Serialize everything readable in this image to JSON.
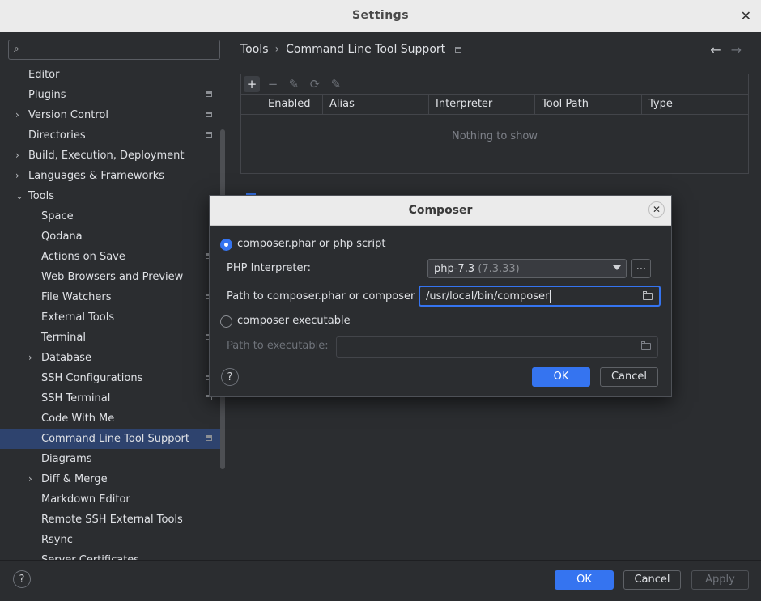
{
  "window": {
    "title": "Settings"
  },
  "sidebar": {
    "search_placeholder": "",
    "items": [
      {
        "label": "Editor",
        "level": 0,
        "expandable": false,
        "gear": false
      },
      {
        "label": "Plugins",
        "level": 0,
        "expandable": false,
        "gear": true
      },
      {
        "label": "Version Control",
        "level": 0,
        "expandable": true,
        "gear": true
      },
      {
        "label": "Directories",
        "level": 0,
        "expandable": false,
        "gear": true
      },
      {
        "label": "Build, Execution, Deployment",
        "level": 0,
        "expandable": true,
        "gear": false
      },
      {
        "label": "Languages & Frameworks",
        "level": 0,
        "expandable": true,
        "gear": false
      },
      {
        "label": "Tools",
        "level": 0,
        "expandable": true,
        "expanded": true,
        "gear": false
      },
      {
        "label": "Space",
        "level": 1,
        "expandable": false,
        "gear": false
      },
      {
        "label": "Qodana",
        "level": 1,
        "expandable": false,
        "gear": false
      },
      {
        "label": "Actions on Save",
        "level": 1,
        "expandable": false,
        "gear": true
      },
      {
        "label": "Web Browsers and Preview",
        "level": 1,
        "expandable": false,
        "gear": false
      },
      {
        "label": "File Watchers",
        "level": 1,
        "expandable": false,
        "gear": true
      },
      {
        "label": "External Tools",
        "level": 1,
        "expandable": false,
        "gear": false
      },
      {
        "label": "Terminal",
        "level": 1,
        "expandable": false,
        "gear": true
      },
      {
        "label": "Database",
        "level": 1,
        "expandable": true,
        "gear": false
      },
      {
        "label": "SSH Configurations",
        "level": 1,
        "expandable": false,
        "gear": true
      },
      {
        "label": "SSH Terminal",
        "level": 1,
        "expandable": false,
        "gear": true
      },
      {
        "label": "Code With Me",
        "level": 1,
        "expandable": false,
        "gear": false
      },
      {
        "label": "Command Line Tool Support",
        "level": 1,
        "expandable": false,
        "gear": true,
        "selected": true
      },
      {
        "label": "Diagrams",
        "level": 1,
        "expandable": false,
        "gear": false
      },
      {
        "label": "Diff & Merge",
        "level": 1,
        "expandable": true,
        "gear": false
      },
      {
        "label": "Markdown Editor",
        "level": 1,
        "expandable": false,
        "gear": false
      },
      {
        "label": "Remote SSH External Tools",
        "level": 1,
        "expandable": false,
        "gear": false
      },
      {
        "label": "Rsync",
        "level": 1,
        "expandable": false,
        "gear": false
      },
      {
        "label": "Server Certificates",
        "level": 1,
        "expandable": false,
        "gear": false
      }
    ]
  },
  "breadcrumb": {
    "parent": "Tools",
    "separator": "›",
    "current": "Command Line Tool Support"
  },
  "table": {
    "columns": [
      "Enabled",
      "Alias",
      "Interpreter",
      "Tool Path",
      "Type"
    ],
    "empty_text": "Nothing to show"
  },
  "dialog": {
    "title": "Composer",
    "option_phar": "composer.phar or php script",
    "interpreter_label": "PHP Interpreter:",
    "interpreter_value": "php-7.3",
    "interpreter_version": "(7.3.33)",
    "more_button": "...",
    "path_label": "Path to composer.phar or composer",
    "path_value": "/usr/local/bin/composer",
    "option_exec": "composer executable",
    "exec_label": "Path to executable:",
    "exec_value": "",
    "ok": "OK",
    "cancel": "Cancel",
    "help": "?"
  },
  "footer": {
    "ok": "OK",
    "cancel": "Cancel",
    "apply": "Apply",
    "help": "?"
  },
  "colors": {
    "accent": "#3574f0",
    "background": "#2b2d30",
    "selection": "#2e436e"
  },
  "icons": [
    "search-icon",
    "chevron-right-icon",
    "chevron-down-icon",
    "gear-icon",
    "back-arrow-icon",
    "forward-arrow-icon",
    "add-icon",
    "remove-icon",
    "edit-icon",
    "refresh-icon",
    "link-icon",
    "folder-icon",
    "close-icon",
    "help-icon"
  ]
}
